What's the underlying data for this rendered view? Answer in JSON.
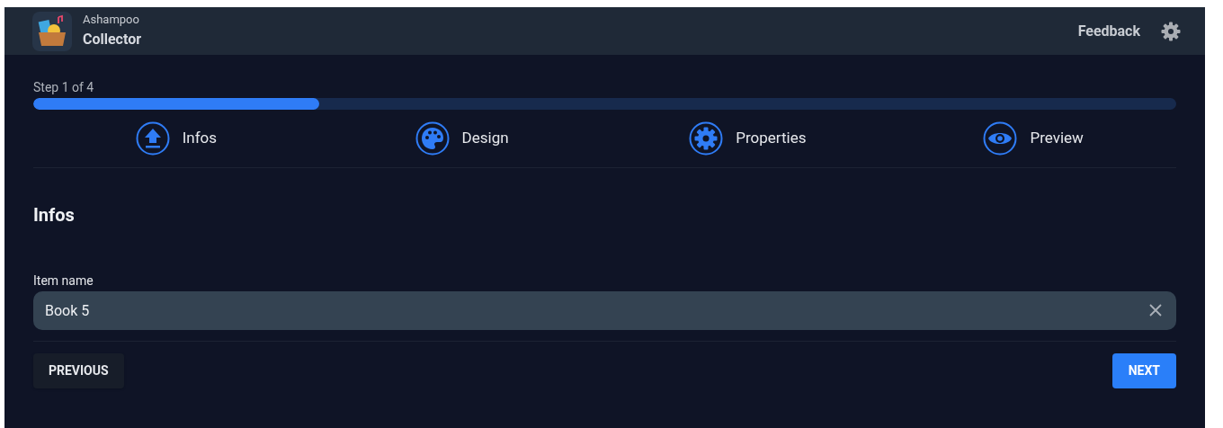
{
  "header": {
    "brand": "Ashampoo",
    "title": "Collector",
    "feedback": "Feedback"
  },
  "progress": {
    "label": "Step 1 of 4",
    "level": 0.25
  },
  "steps": [
    {
      "kind": "upload",
      "label": "Infos"
    },
    {
      "kind": "palette",
      "label": "Design"
    },
    {
      "kind": "gear",
      "label": "Properties"
    },
    {
      "kind": "eye",
      "label": "Preview"
    }
  ],
  "section": {
    "title": "Infos"
  },
  "field": {
    "label": "Item name",
    "value": "Book 5"
  },
  "buttons": {
    "previous": "PREVIOUS",
    "next": "NEXT"
  }
}
